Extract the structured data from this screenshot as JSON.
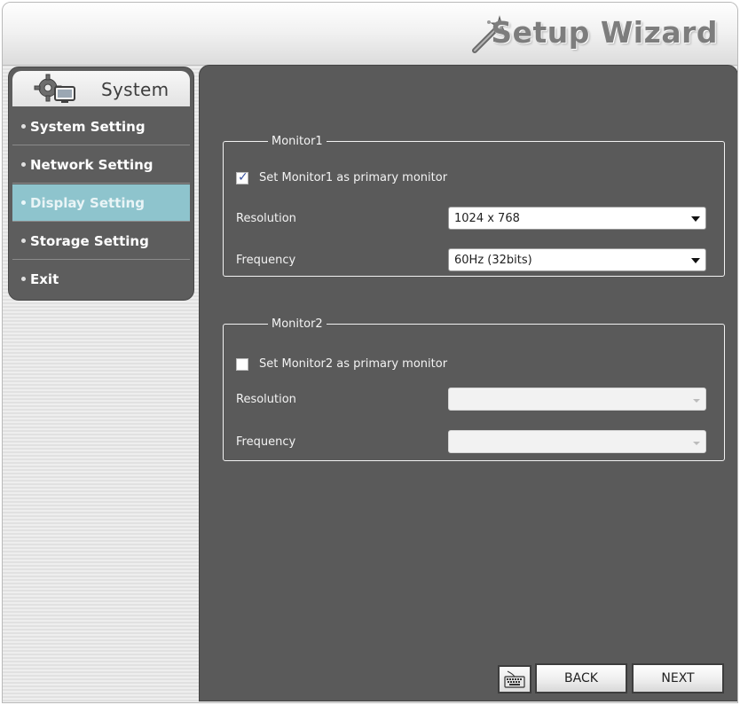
{
  "window": {
    "title": "Setup Wizard"
  },
  "sidebar": {
    "header": "System",
    "items": [
      {
        "label": "System Setting",
        "active": false
      },
      {
        "label": "Network Setting",
        "active": false
      },
      {
        "label": "Display Setting",
        "active": true
      },
      {
        "label": "Storage Setting",
        "active": false
      },
      {
        "label": "Exit",
        "active": false
      }
    ]
  },
  "monitor1": {
    "legend": "Monitor1",
    "primary_label": "Set Monitor1  as primary monitor",
    "primary_checked": true,
    "resolution_label": "Resolution",
    "resolution_value": "1024 x 768",
    "frequency_label": "Frequency",
    "frequency_value": "60Hz (32bits)"
  },
  "monitor2": {
    "legend": "Monitor2",
    "primary_label": "Set Monitor2  as primary monitor",
    "primary_checked": false,
    "resolution_label": "Resolution",
    "resolution_value": "",
    "frequency_label": "Frequency",
    "frequency_value": ""
  },
  "buttons": {
    "keyboard_icon": "keyboard-icon",
    "back_label": "BACK",
    "next_label": "NEXT"
  },
  "colors": {
    "panel_background": "#5a5a5a",
    "active_nav": "#8ec4cd",
    "title_text": "#7d7d7d"
  }
}
